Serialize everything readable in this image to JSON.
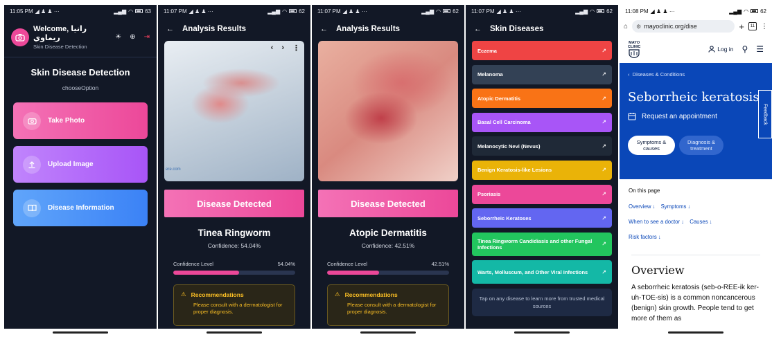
{
  "status_bars": [
    {
      "time": "11:05 PM",
      "icons": "◢ ♟ ♟ ···",
      "battery": "63"
    },
    {
      "time": "11:07 PM",
      "icons": "◢ ♟ ♟ ···",
      "battery": "62"
    },
    {
      "time": "11:07 PM",
      "icons": "◢ ♟ ♟ ···",
      "battery": "62"
    },
    {
      "time": "11:07 PM",
      "icons": "◢ ♟ ♟ ···",
      "battery": "62"
    },
    {
      "time": "11:08 PM",
      "icons": "◢ ♟ ♟ ···",
      "battery": "62"
    }
  ],
  "home": {
    "welcome": "Welcome, رانيا ريماوي",
    "subtitle": "Skin Disease Detection",
    "title": "Skin Disease Detection",
    "choose": "chooseOption",
    "take_photo": "Take Photo",
    "upload_image": "Upload Image",
    "disease_info": "Disease Information"
  },
  "results": [
    {
      "title": "Analysis Results",
      "detected": "Disease Detected",
      "disease": "Tinea Ringworm",
      "confidence_text": "Confidence: 54.04%",
      "confidence_label": "Confidence Level",
      "confidence_value": "54.04%",
      "confidence_fraction": 0.5404,
      "reco_title": "Recommendations",
      "reco_body": "Please consult with a dermatologist for proper diagnosis.",
      "photo_caption": "ere.com"
    },
    {
      "title": "Analysis Results",
      "detected": "Disease Detected",
      "disease": "Atopic Dermatitis",
      "confidence_text": "Confidence: 42.51%",
      "confidence_label": "Confidence Level",
      "confidence_value": "42.51%",
      "confidence_fraction": 0.4251,
      "reco_title": "Recommendations",
      "reco_body": "Please consult with a dermatologist for proper diagnosis."
    }
  ],
  "skin_list": {
    "title": "Skin Diseases",
    "items": [
      {
        "name": "Eczema",
        "color": "#ef4444"
      },
      {
        "name": "Melanoma",
        "color": "#334155"
      },
      {
        "name": "Atopic Dermatitis",
        "color": "#f97316"
      },
      {
        "name": "Basal Cell Carcinoma",
        "color": "#a855f7"
      },
      {
        "name": "Melanocytic Nevi (Nevus)",
        "color": "#1f2937"
      },
      {
        "name": "Benign Keratosis-like Lesions",
        "color": "#eab308"
      },
      {
        "name": "Psoriasis",
        "color": "#ec4899"
      },
      {
        "name": "Seborrheic Keratoses",
        "color": "#6366f1"
      },
      {
        "name": "Tinea Ringworm Candidiasis and other Fungal Infections",
        "color": "#22c55e"
      },
      {
        "name": "Warts, Molluscum, and Other Viral Infections",
        "color": "#14b8a6"
      }
    ],
    "hint": "Tap on any disease to learn more from trusted medical sources"
  },
  "browser": {
    "url": "mayoclinic.org/dise",
    "tabs": "11",
    "logo_line1": "MAYO",
    "logo_line2": "CLINIC",
    "login": "Log in",
    "breadcrumb": "Diseases & Conditions",
    "title": "Seborrheic keratosis",
    "appointment": "Request an appointment",
    "pill_active": "Symptoms & causes",
    "pill_inactive": "Diagnosis & treatment",
    "feedback": "Feedback",
    "on_page": "On this page",
    "links": [
      "Overview ↓",
      "Symptoms ↓",
      "When to see a doctor ↓",
      "Causes ↓",
      "Risk factors ↓"
    ],
    "overview_heading": "Overview",
    "overview_text": "A seborrheic keratosis (seb-o-REE-ik ker-uh-TOE-sis) is a common noncancerous (benign) skin growth. People tend to get more of them as"
  }
}
